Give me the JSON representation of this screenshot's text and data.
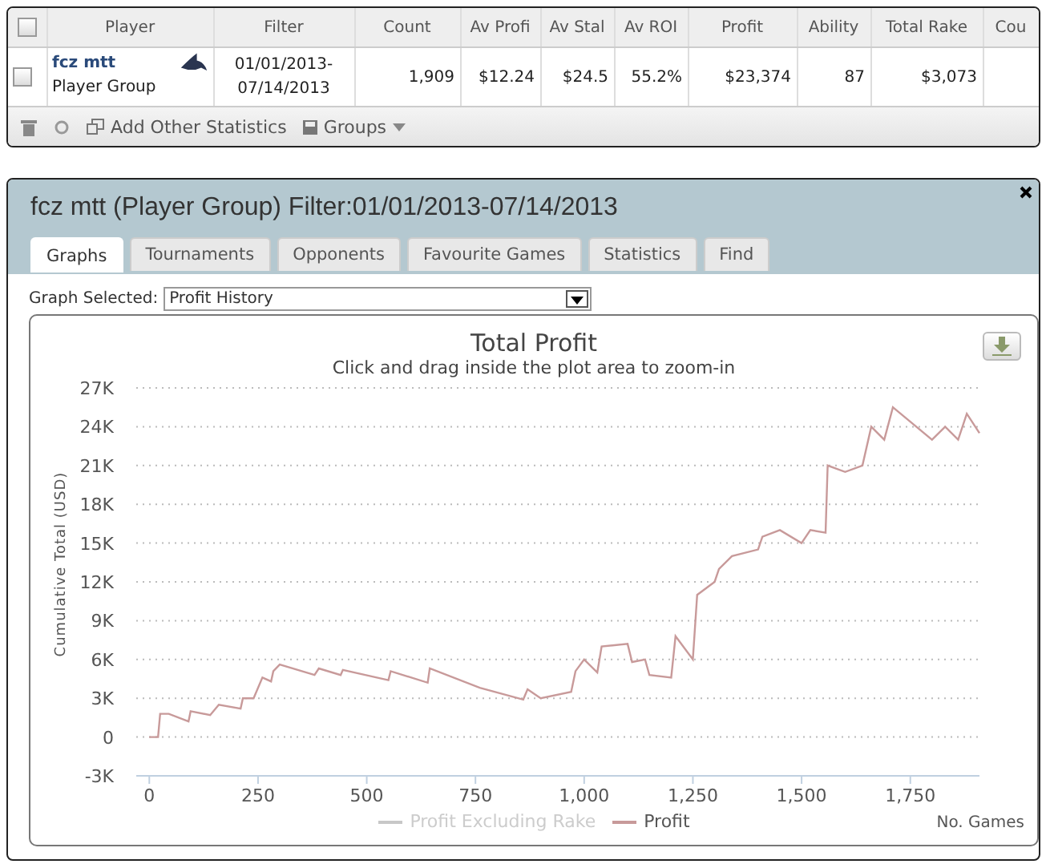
{
  "stats_table": {
    "columns": [
      "Player",
      "Filter",
      "Count",
      "Av Profi",
      "Av Stal",
      "Av ROI",
      "Profit",
      "Ability",
      "Total Rake",
      "Cou"
    ],
    "rows": [
      {
        "checked": false,
        "player": "fcz mtt",
        "group": "Player Group",
        "filter": "01/01/2013-07/14/2013",
        "count": "1,909",
        "av_profit": "$12.24",
        "av_stake": "$24.5",
        "av_roi": "55.2%",
        "profit": "$23,374",
        "ability": "87",
        "total_rake": "$3,073"
      }
    ],
    "header_checked": false,
    "toolbar": {
      "add_label": "Add Other Statistics",
      "groups_label": "Groups"
    }
  },
  "panel": {
    "title": "fcz mtt (Player Group) Filter:01/01/2013-07/14/2013",
    "tabs": [
      {
        "label": "Graphs",
        "selected": true
      },
      {
        "label": "Tournaments",
        "selected": false
      },
      {
        "label": "Opponents",
        "selected": false
      },
      {
        "label": "Favourite Games",
        "selected": false
      },
      {
        "label": "Statistics",
        "selected": false
      },
      {
        "label": "Find",
        "selected": false
      }
    ],
    "graph_select": {
      "label": "Graph Selected:",
      "value": "Profit History"
    },
    "legend": [
      {
        "name": "Profit Excluding Rake",
        "hidden": true,
        "color": "#c8c8c8"
      }
    ],
    "chart_data": {
      "type": "line",
      "grid": true,
      "title": "Total Profit",
      "subtitle": "Click and drag inside the plot area to zoom-in",
      "xlabel": "No. Games",
      "ylabel": "Cumulative Total (USD)",
      "x": [
        0,
        20,
        25,
        45,
        90,
        95,
        140,
        160,
        210,
        215,
        240,
        260,
        280,
        285,
        300,
        380,
        390,
        440,
        445,
        550,
        555,
        640,
        645,
        760,
        860,
        870,
        900,
        970,
        980,
        1000,
        1030,
        1040,
        1100,
        1110,
        1140,
        1150,
        1200,
        1210,
        1250,
        1260,
        1300,
        1310,
        1340,
        1400,
        1410,
        1450,
        1500,
        1520,
        1555,
        1560,
        1600,
        1640,
        1660,
        1690,
        1710,
        1800,
        1830,
        1860,
        1880,
        1909
      ],
      "series": [
        {
          "name": "Profit",
          "color": "#c89a9a",
          "values": [
            0,
            0,
            1800,
            1800,
            1200,
            2000,
            1700,
            2500,
            2200,
            3000,
            3000,
            4600,
            4300,
            5100,
            5600,
            4800,
            5300,
            4800,
            5200,
            4400,
            5100,
            4200,
            5300,
            3800,
            2900,
            3700,
            3000,
            3500,
            5100,
            6000,
            5000,
            7000,
            7200,
            5800,
            6000,
            4800,
            4600,
            7800,
            6000,
            11000,
            12000,
            13000,
            14000,
            14500,
            15500,
            16000,
            15000,
            16000,
            15800,
            21000,
            20500,
            21000,
            24000,
            23000,
            25500,
            23000,
            24000,
            23000,
            25000,
            23500
          ]
        }
      ],
      "xlim": [
        -30,
        1909
      ],
      "ylim": [
        -3000,
        27000
      ],
      "xticks": [
        {
          "value": 0,
          "label": "0"
        },
        {
          "value": 250,
          "label": "250"
        },
        {
          "value": 500,
          "label": "500"
        },
        {
          "value": 750,
          "label": "750"
        },
        {
          "value": 1000,
          "label": "1,000"
        },
        {
          "value": 1250,
          "label": "1,250"
        },
        {
          "value": 1500,
          "label": "1,500"
        },
        {
          "value": 1750,
          "label": "1,750"
        }
      ],
      "yticks": [
        {
          "value": -3000,
          "label": "-3K"
        },
        {
          "value": 0,
          "label": "0"
        },
        {
          "value": 3000,
          "label": "3K"
        },
        {
          "value": 6000,
          "label": "6K"
        },
        {
          "value": 9000,
          "label": "9K"
        },
        {
          "value": 12000,
          "label": "12K"
        },
        {
          "value": 15000,
          "label": "15K"
        },
        {
          "value": 18000,
          "label": "18K"
        },
        {
          "value": 21000,
          "label": "21K"
        },
        {
          "value": 24000,
          "label": "24K"
        },
        {
          "value": 27000,
          "label": "27K"
        }
      ]
    }
  }
}
